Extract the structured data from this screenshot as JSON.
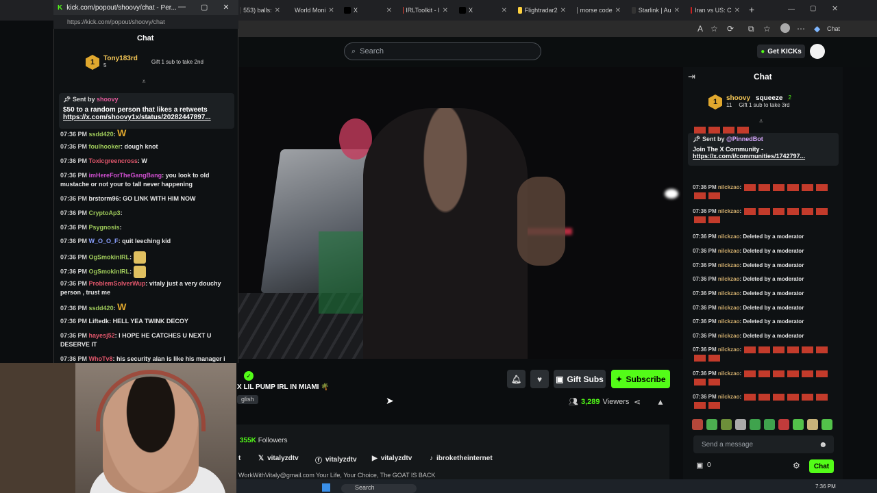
{
  "browser": {
    "tabs": [
      {
        "label": "553) balls:",
        "color": "#444"
      },
      {
        "label": "World Moni",
        "color": "#2a6fdb"
      },
      {
        "label": "X",
        "color": "#000"
      },
      {
        "label": "IRLToolkit - I",
        "color": "#e34234"
      },
      {
        "label": "X",
        "color": "#000"
      },
      {
        "label": "Flightradar2",
        "color": "#ffd23f"
      },
      {
        "label": "morse code",
        "color": "#888"
      },
      {
        "label": "Starlink | Au",
        "color": "#333"
      },
      {
        "label": "Iran vs US: C",
        "color": "#c22"
      }
    ],
    "new_tab": "+",
    "profile_chat": "Chat"
  },
  "kick": {
    "search_placeholder": "Search",
    "get_kicks": "Get KICKs"
  },
  "popout": {
    "window_title": "kick.com/popout/shoovy/chat - Per...",
    "url": "https://kick.com/popout/shoovy/chat",
    "chat_title": "Chat",
    "leader": {
      "rank": "1",
      "name": "Tony183rd",
      "count": "5",
      "gift_text": "Gift 1 sub to take 2nd"
    },
    "pinned": {
      "sender_prefix": "Sent by",
      "sender": "shoovy",
      "message": "$50 to a random person that likes a retweets",
      "link": "https://x.com/shoovy1x/status/20282447897..."
    },
    "messages": [
      {
        "time": "07:36 PM",
        "user": "ssdd420",
        "color": "#9ec95a",
        "text": "W",
        "emote": "w"
      },
      {
        "time": "07:36 PM",
        "user": "foulhooker",
        "color": "#9ec95a",
        "text": "dough knot"
      },
      {
        "time": "07:36 PM",
        "user": "Toxicgreencross",
        "color": "#e0566b",
        "text": "W"
      },
      {
        "time": "07:36 PM",
        "user": "imHereForTheGangBang",
        "color": "#d14fd1",
        "text": "you look to old mustache or not your to tall never happening"
      },
      {
        "time": "07:36 PM",
        "user": "brstorm96",
        "color": "#e8e8e8",
        "text": "GO LINK WITH HIM NOW"
      },
      {
        "time": "07:36 PM",
        "user": "CryptoAp3",
        "color": "#9ec95a",
        "text": ""
      },
      {
        "time": "07:36 PM",
        "user": "Psygnosis",
        "color": "#9ec95a",
        "text": ""
      },
      {
        "time": "07:36 PM",
        "user": "W_O_O_F",
        "color": "#8aa0ff",
        "text": "quit leeching kid"
      },
      {
        "time": "07:36 PM",
        "user": "OgSmokinIRL",
        "color": "#9ec95a",
        "text": "",
        "emote": "face"
      },
      {
        "time": "07:36 PM",
        "user": "OgSmokinIRL",
        "color": "#9ec95a",
        "text": "",
        "emote": "face"
      },
      {
        "time": "07:36 PM",
        "user": "ProblemSolverWup",
        "color": "#e0566b",
        "text": "vitaly just a very douchy person , trust me"
      },
      {
        "time": "07:36 PM",
        "user": "ssdd420",
        "color": "#9ec95a",
        "text": "W",
        "emote": "w"
      },
      {
        "time": "07:36 PM",
        "user": "Liftedk",
        "color": "#e8e8e8",
        "text": "HELL YEA TWINK DECOY"
      },
      {
        "time": "07:36 PM",
        "user": "hayesj52",
        "color": "#e0566b",
        "text": "I HOPE HE CATCHES U NEXT U DESERVE IT"
      },
      {
        "time": "07:36 PM",
        "user": "WhoTv8",
        "color": "#e0566b",
        "text": "his security alan is like his manager i"
      }
    ]
  },
  "stream": {
    "title": "X LIL PUMP IRL IN MIAMI 🌴",
    "language": "glish",
    "gift_subs": "Gift Subs",
    "subscribe": "Subscribe",
    "viewers_count": "3,289",
    "viewers_label": "Viewers",
    "followers_count": "355K",
    "followers_label": "Followers",
    "socials": [
      {
        "icon": "x-icon",
        "glyph": "𝕏",
        "label": "vitalyzdtv"
      },
      {
        "icon": "facebook-icon",
        "glyph": "ⓕ",
        "label": "vitalyzdtv"
      },
      {
        "icon": "youtube-icon",
        "glyph": "▶",
        "label": "vitalyzdtv"
      },
      {
        "icon": "tiktok-icon",
        "glyph": "♪",
        "label": "ibroketheinternet"
      }
    ],
    "social_prefix": "t",
    "bio": "WorkWithVitaly@gmail.com Your Life, Your Choice, The GOAT IS BACK"
  },
  "right_chat": {
    "title": "Chat",
    "leader": {
      "rank": "1",
      "name": "shoovy",
      "name2": "squeeze",
      "count": "11",
      "count2": "2",
      "gift_text": "Gift 1 sub to take 3rd"
    },
    "pinned": {
      "sender_prefix": "Sent by",
      "sender": "@PinnedBot",
      "message": "Join The X Community -",
      "link": "https://x.com/i/communities/1742797..."
    },
    "messages": [
      {
        "time": "",
        "user": "",
        "text": "",
        "emotes": 4
      },
      {
        "time": "07:36 PM",
        "user": "nilckzao",
        "text": "",
        "emotes": 8
      },
      {
        "time": "07:36 PM",
        "user": "nilckzao",
        "text": "",
        "emotes": 8
      },
      {
        "time": "07:36 PM",
        "user": "nilckzao",
        "text": "Deleted by a moderator"
      },
      {
        "time": "07:36 PM",
        "user": "nilckzao",
        "text": "Deleted by a moderator"
      },
      {
        "time": "07:36 PM",
        "user": "nilckzao",
        "text": "Deleted by a moderator"
      },
      {
        "time": "07:36 PM",
        "user": "nilckzao",
        "text": "Deleted by a moderator"
      },
      {
        "time": "07:36 PM",
        "user": "nilckzao",
        "text": "Deleted by a moderator"
      },
      {
        "time": "07:36 PM",
        "user": "nilckzao",
        "text": "Deleted by a moderator"
      },
      {
        "time": "07:36 PM",
        "user": "nilckzao",
        "text": "Deleted by a moderator"
      },
      {
        "time": "07:36 PM",
        "user": "nilckzao",
        "text": "Deleted by a moderator"
      },
      {
        "time": "07:36 PM",
        "user": "nilckzao",
        "text": "",
        "emotes": 8
      },
      {
        "time": "07:36 PM",
        "user": "nilckzao",
        "text": "",
        "emotes": 8
      },
      {
        "time": "07:36 PM",
        "user": "nilckzao",
        "text": "",
        "emotes": 8
      }
    ],
    "input_placeholder": "Send a message",
    "kicks_count": "0",
    "chat_button": "Chat",
    "emote_colors": [
      "#b3473a",
      "#4caf50",
      "#6d8f3a",
      "#aaa",
      "#3fa34d",
      "#3fa34d",
      "#c23b3b",
      "#53c24a",
      "#c9b47a",
      "#53c24a"
    ]
  },
  "taskbar": {
    "search": "Search",
    "clock": "7:36 PM"
  }
}
